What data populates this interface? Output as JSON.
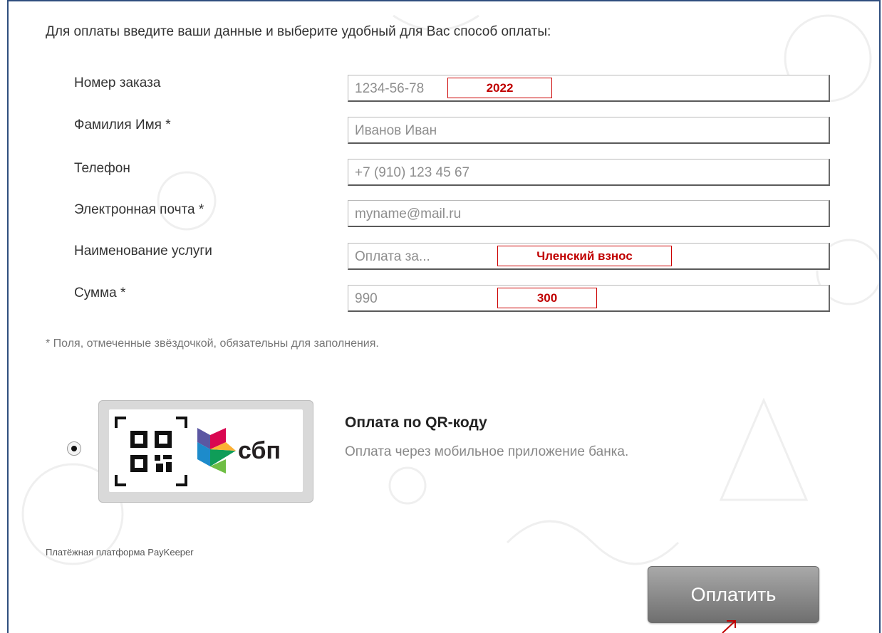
{
  "intro_text": "Для оплаты введите ваши данные и выберите удобный для Вас способ оплаты:",
  "fields": [
    {
      "label": "Номер заказа",
      "placeholder": "1234-56-78",
      "annotation": "2022"
    },
    {
      "label": "Фамилия Имя *",
      "placeholder": "Иванов Иван"
    },
    {
      "label": "Телефон",
      "placeholder": "+7 (910) 123 45 67"
    },
    {
      "label": "Электронная почта *",
      "placeholder": "myname@mail.ru"
    },
    {
      "label": "Наименование услуги",
      "placeholder": "Оплата за...",
      "annotation": "Членский взнос"
    },
    {
      "label": "Сумма *",
      "placeholder": "990",
      "annotation": "300"
    }
  ],
  "required_note": "* Поля, отмеченные звёздочкой, обязательны для заполнения.",
  "payment_method": {
    "logo_text": "сбп",
    "title": "Оплата по QR-коду",
    "description": "Оплата через мобильное приложение банка.",
    "selected": true
  },
  "platform_text": "Платёжная платформа PayKeeper",
  "pay_button_label": "Оплатить",
  "colors": {
    "annotation": "#c00000",
    "frame": "#2f4e7e",
    "button": "#8a8a8a"
  }
}
